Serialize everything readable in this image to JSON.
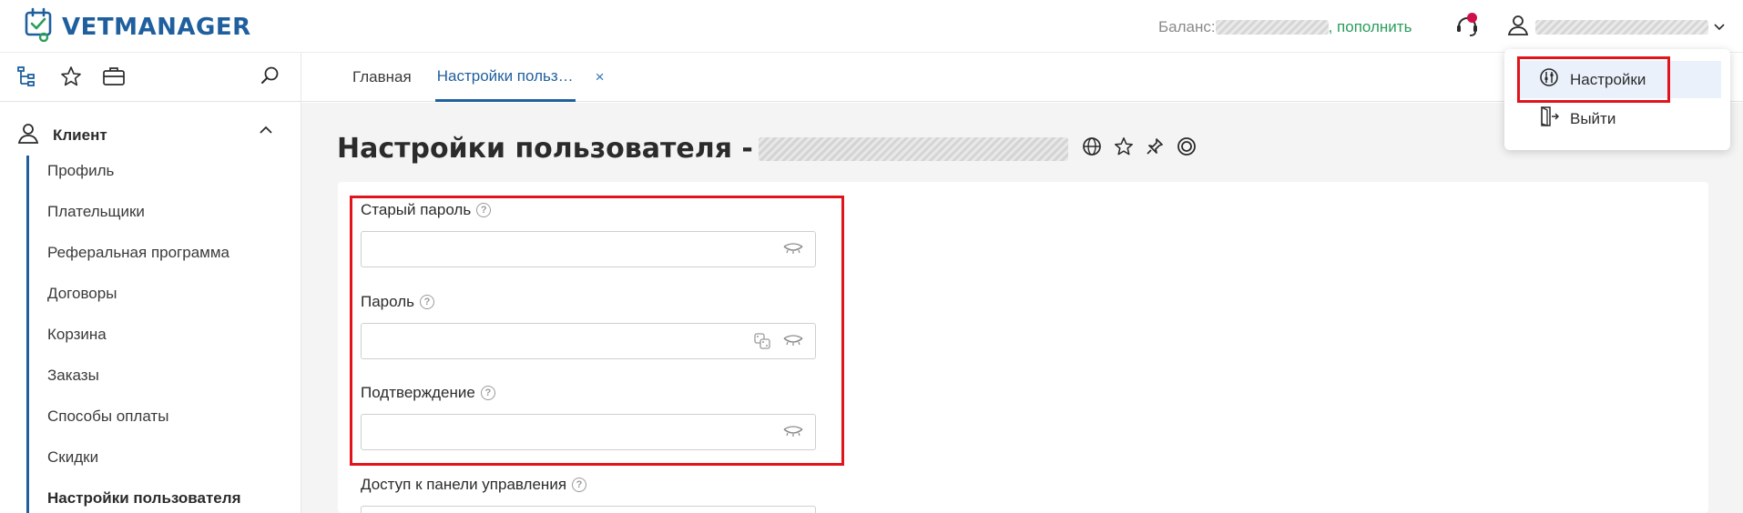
{
  "app": {
    "name": "VETMANAGER"
  },
  "header": {
    "balance_label": "Баланс:",
    "topup_label": ", пополнить",
    "colors": {
      "brand": "#1f5f9e",
      "topup": "#2a9d5b",
      "notification": "#d0104c"
    }
  },
  "nav_icons": [
    "tree-icon",
    "star-icon",
    "briefcase-icon",
    "search-icon"
  ],
  "tabs": [
    {
      "label": "Главная"
    },
    {
      "label": "Настройки польз…",
      "close": "×"
    }
  ],
  "sidebar": {
    "section_title": "Клиент",
    "items": [
      {
        "label": "Профиль"
      },
      {
        "label": "Плательщики"
      },
      {
        "label": "Реферальная программа"
      },
      {
        "label": "Договоры"
      },
      {
        "label": "Корзина"
      },
      {
        "label": "Заказы"
      },
      {
        "label": "Способы оплаты"
      },
      {
        "label": "Скидки"
      },
      {
        "label": "Настройки пользователя"
      }
    ]
  },
  "page": {
    "title": "Настройки пользователя -",
    "title_icons": [
      "globe-icon",
      "star-icon",
      "pin-icon",
      "lifebuoy-icon"
    ]
  },
  "form": {
    "old_password": {
      "label": "Старый пароль",
      "value": "",
      "help": "?"
    },
    "password": {
      "label": "Пароль",
      "value": "",
      "help": "?"
    },
    "confirm": {
      "label": "Подтверждение",
      "value": "",
      "help": "?"
    },
    "panel_access": {
      "label": "Доступ к панели управления",
      "help": "?"
    }
  },
  "user_menu": {
    "items": [
      {
        "label": "Настройки",
        "icon": "settings-sliders-icon"
      },
      {
        "label": "Выйти",
        "icon": "logout-door-icon"
      }
    ]
  }
}
